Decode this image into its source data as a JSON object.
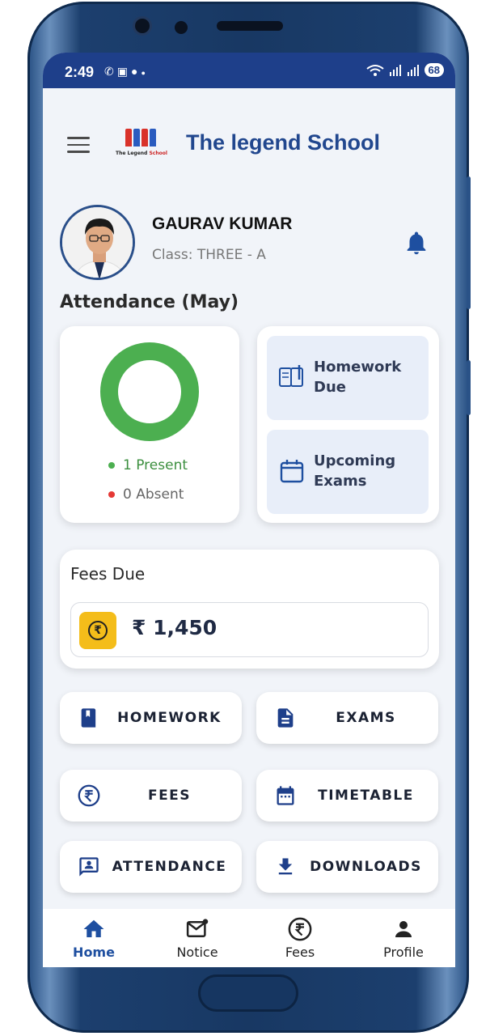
{
  "status_bar": {
    "time": "2:49",
    "left_icons": [
      "phone-call-icon",
      "sim-icon",
      "chat-icon",
      "dot-icon"
    ],
    "right_icons": [
      "wifi-icon",
      "signal-icon",
      "signal-icon"
    ],
    "battery": "68"
  },
  "header": {
    "school_name": "The legend School",
    "logo_text_black": "The Legend",
    "logo_text_red": "School"
  },
  "profile": {
    "name": "GAURAV KUMAR",
    "class_label": "Class: THREE - A"
  },
  "attendance": {
    "title": "Attendance (May)",
    "present": 1,
    "absent": 0,
    "present_label": "1 Present",
    "absent_label": "0 Absent",
    "present_color": "#4caf50",
    "absent_color": "#e53935"
  },
  "due": {
    "homework_label": "Homework Due",
    "exams_label": "Upcoming Exams"
  },
  "fees": {
    "title": "Fees Due",
    "amount": "₹ 1,450",
    "coin_symbol": "₹"
  },
  "quick_actions": [
    {
      "label": "HOMEWORK",
      "icon": "book-icon"
    },
    {
      "label": "EXAMS",
      "icon": "document-icon"
    },
    {
      "label": "FEES",
      "icon": "rupee-icon"
    },
    {
      "label": "TIMETABLE",
      "icon": "calendar-icon"
    },
    {
      "label": "ATTENDANCE",
      "icon": "person-card-icon"
    },
    {
      "label": "DOWNLOADS",
      "icon": "download-icon"
    }
  ],
  "bottom_nav": [
    {
      "label": "Home",
      "icon": "home-icon",
      "active": true
    },
    {
      "label": "Notice",
      "icon": "mail-icon",
      "active": false
    },
    {
      "label": "Fees",
      "icon": "rupee-icon",
      "active": false
    },
    {
      "label": "Profile",
      "icon": "person-icon",
      "active": false
    }
  ],
  "colors": {
    "primary": "#1e3f8a",
    "accent_yellow": "#f4bd1a",
    "due_bg": "#e8eef9"
  }
}
